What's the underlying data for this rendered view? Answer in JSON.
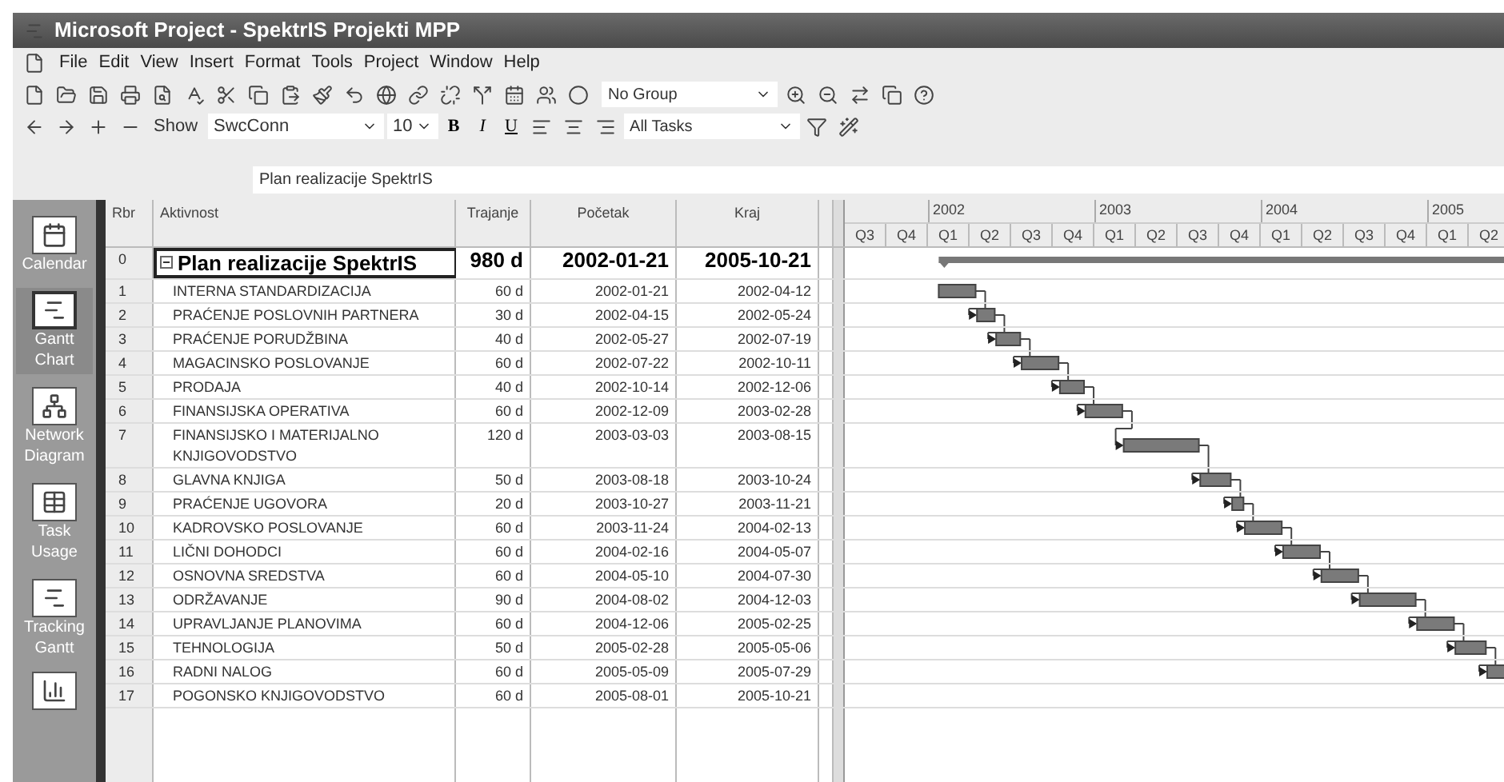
{
  "window": {
    "title": "Microsoft Project - SpektrIS Projekti MPP"
  },
  "menu": [
    "File",
    "Edit",
    "View",
    "Insert",
    "Format",
    "Tools",
    "Project",
    "Window",
    "Help"
  ],
  "toolbar": {
    "group": "No Group",
    "show": "Show",
    "font": "SwcConn",
    "size": "10",
    "bold": "B",
    "italic": "I",
    "underline": "U",
    "filter": "All Tasks"
  },
  "entry_bar": {
    "value": "Plan realizacije SpektrIS"
  },
  "views": [
    {
      "label": "Calendar",
      "selected": false
    },
    {
      "label": "Gantt Chart",
      "selected": true
    },
    {
      "label": "Network Diagram",
      "selected": false
    },
    {
      "label": "Task Usage",
      "selected": false
    },
    {
      "label": "Tracking Gantt",
      "selected": false
    }
  ],
  "table": {
    "columns": [
      "Rbr",
      "Aktivnost",
      "Trajanje",
      "Početak",
      "Kraj"
    ],
    "rows": [
      {
        "id": "0",
        "name": "Plan realizacije SpektrIS",
        "duration": "980 d",
        "start": "2002-01-21",
        "end": "2005-10-21",
        "kind": "summary",
        "selected": true
      },
      {
        "id": "1",
        "name": "INTERNA STANDARDIZACIJA",
        "duration": "60 d",
        "start": "2002-01-21",
        "end": "2002-04-12",
        "kind": "task",
        "selected": false
      },
      {
        "id": "2",
        "name": "PRAĆENJE POSLOVNIH PARTNERA",
        "duration": "30 d",
        "start": "2002-04-15",
        "end": "2002-05-24",
        "kind": "task",
        "selected": false
      },
      {
        "id": "3",
        "name": "PRAĆENJE PORUDŽBINA",
        "duration": "40 d",
        "start": "2002-05-27",
        "end": "2002-07-19",
        "kind": "task",
        "selected": false
      },
      {
        "id": "4",
        "name": "MAGACINSKO POSLOVANJE",
        "duration": "60 d",
        "start": "2002-07-22",
        "end": "2002-10-11",
        "kind": "task",
        "selected": false
      },
      {
        "id": "5",
        "name": "PRODAJA",
        "duration": "40 d",
        "start": "2002-10-14",
        "end": "2002-12-06",
        "kind": "task",
        "selected": false
      },
      {
        "id": "6",
        "name": "FINANSIJSKA OPERATIVA",
        "duration": "60 d",
        "start": "2002-12-09",
        "end": "2003-02-28",
        "kind": "task",
        "selected": false
      },
      {
        "id": "7",
        "name": "FINANSIJSKO I MATERIJALNO KNJIGOVODSTVO",
        "duration": "120 d",
        "start": "2003-03-03",
        "end": "2003-08-15",
        "kind": "task",
        "selected": false
      },
      {
        "id": "8",
        "name": "GLAVNA KNJIGA",
        "duration": "50 d",
        "start": "2003-08-18",
        "end": "2003-10-24",
        "kind": "task",
        "selected": false
      },
      {
        "id": "9",
        "name": "PRAĆENJE UGOVORA",
        "duration": "20 d",
        "start": "2003-10-27",
        "end": "2003-11-21",
        "kind": "task",
        "selected": false
      },
      {
        "id": "10",
        "name": "KADROVSKO POSLOVANJE",
        "duration": "60 d",
        "start": "2003-11-24",
        "end": "2004-02-13",
        "kind": "task",
        "selected": false
      },
      {
        "id": "11",
        "name": "LIČNI DOHODCI",
        "duration": "60 d",
        "start": "2004-02-16",
        "end": "2004-05-07",
        "kind": "task",
        "selected": false
      },
      {
        "id": "12",
        "name": "OSNOVNA SREDSTVA",
        "duration": "60 d",
        "start": "2004-05-10",
        "end": "2004-07-30",
        "kind": "task",
        "selected": false
      },
      {
        "id": "13",
        "name": "ODRŽAVANJE",
        "duration": "90 d",
        "start": "2004-08-02",
        "end": "2004-12-03",
        "kind": "task",
        "selected": false
      },
      {
        "id": "14",
        "name": "UPRAVLJANJE PLANOVIMA",
        "duration": "60 d",
        "start": "2004-12-06",
        "end": "2005-02-25",
        "kind": "task",
        "selected": false
      },
      {
        "id": "15",
        "name": "TEHNOLOGIJA",
        "duration": "50 d",
        "start": "2005-02-28",
        "end": "2005-05-06",
        "kind": "task",
        "selected": false
      },
      {
        "id": "16",
        "name": "RADNI NALOG",
        "duration": "60 d",
        "start": "2005-05-09",
        "end": "2005-07-29",
        "kind": "task",
        "selected": false
      },
      {
        "id": "17",
        "name": "POGONSKO KNJIGOVODSTVO",
        "duration": "60 d",
        "start": "2005-08-01",
        "end": "2005-10-21",
        "kind": "task",
        "selected": false
      }
    ]
  },
  "timeline": {
    "years": [
      "2002",
      "2003",
      "2004",
      "2005"
    ],
    "quarters": [
      "Q3",
      "Q4",
      "Q1",
      "Q2",
      "Q3",
      "Q4",
      "Q1",
      "Q2",
      "Q3",
      "Q4",
      "Q1",
      "Q2",
      "Q3",
      "Q4",
      "Q1",
      "Q2"
    ]
  }
}
